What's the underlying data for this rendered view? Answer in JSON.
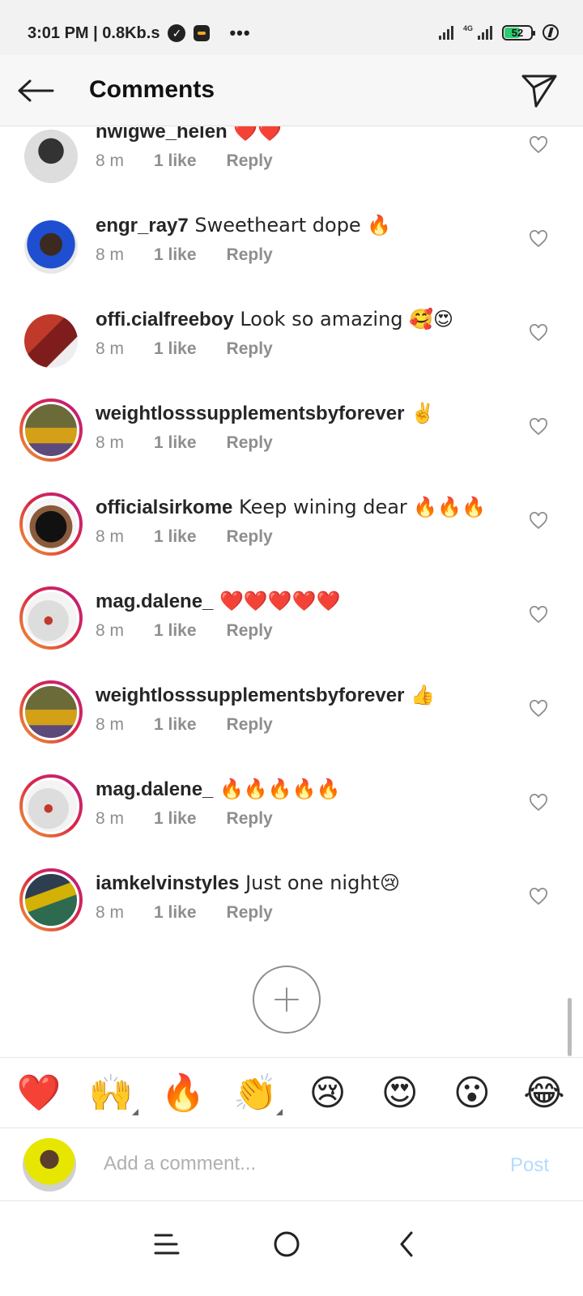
{
  "status_bar": {
    "time": "3:01 PM | 0.8Kb.s",
    "dots": "•••",
    "network": "4G",
    "battery": "52"
  },
  "header": {
    "title": "Comments"
  },
  "comments": [
    {
      "username": "nwigwe_helen",
      "text": " ❤️❤️",
      "time": "8 m",
      "likes": "1 like",
      "reply": "Reply"
    },
    {
      "username": "engr_ray7",
      "text": " Sweetheart dope 🔥",
      "time": "8 m",
      "likes": "1 like",
      "reply": "Reply"
    },
    {
      "username": "offi.cialfreeboy",
      "text": " Look so amazing 🥰😍",
      "time": "8 m",
      "likes": "1 like",
      "reply": "Reply"
    },
    {
      "username": "weightlosssupplementsbyforever",
      "text": " ✌️",
      "time": "8 m",
      "likes": "1 like",
      "reply": "Reply"
    },
    {
      "username": "officialsirkome",
      "text": " Keep wining dear 🔥🔥🔥",
      "time": "8 m",
      "likes": "1 like",
      "reply": "Reply"
    },
    {
      "username": "mag.dalene_",
      "text": " ❤️❤️❤️❤️❤️",
      "time": "8 m",
      "likes": "1 like",
      "reply": "Reply"
    },
    {
      "username": "weightlosssupplementsbyforever",
      "text": " 👍",
      "time": "8 m",
      "likes": "1 like",
      "reply": "Reply"
    },
    {
      "username": "mag.dalene_",
      "text": " 🔥🔥🔥🔥🔥",
      "time": "8 m",
      "likes": "1 like",
      "reply": "Reply"
    },
    {
      "username": "iamkelvinstyles",
      "text": " Just one night😢",
      "time": "8 m",
      "likes": "1 like",
      "reply": "Reply"
    }
  ],
  "quick_emojis": [
    "❤️",
    "🙌",
    "🔥",
    "👏",
    "😢",
    "😍",
    "😮",
    "😂"
  ],
  "compose": {
    "placeholder": "Add a comment...",
    "post_label": "Post"
  },
  "colors": {
    "story_ring_start": "#f09433",
    "story_ring_end": "#bc1888",
    "post_disabled": "#b3dbff",
    "meta_gray": "#8e8e8e"
  }
}
